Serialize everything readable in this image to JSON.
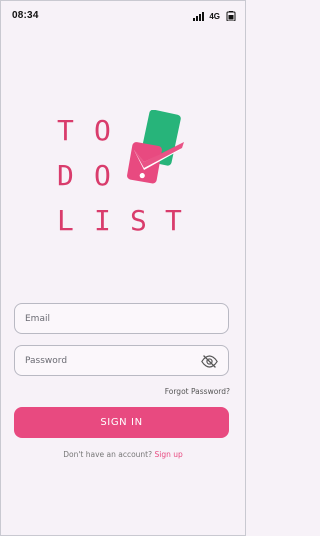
{
  "status_bar": {
    "time": "08:34",
    "network": "4G"
  },
  "logo": {
    "letters": [
      "T",
      "O",
      "D",
      "O",
      "L",
      "I",
      "S",
      "T"
    ],
    "colors": {
      "letters": "#d93c6c",
      "phone_green": "#27b47a",
      "phone_pink": "#e84a80"
    }
  },
  "form": {
    "email_placeholder": "Email",
    "password_placeholder": "Password",
    "forgot_password": "Forgot Password?",
    "sign_in_label": "SIGN IN",
    "no_account_text": "Don't have an account?",
    "sign_up_label": "Sign up"
  },
  "colors": {
    "background": "#f7f2f8",
    "accent": "#e84a80"
  }
}
